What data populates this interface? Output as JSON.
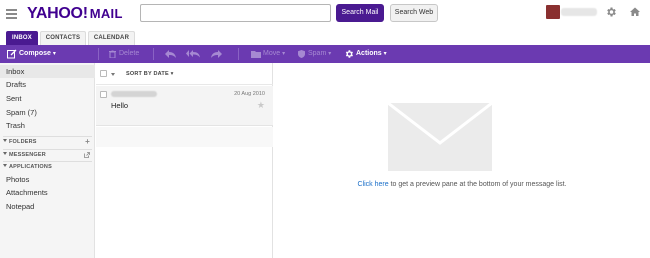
{
  "header": {
    "logo": "YAHOO!",
    "logo_mail": "MAIL",
    "search_value": "",
    "search_placeholder": "",
    "search_mail_label": "Search Mail",
    "search_web_label": "Search Web"
  },
  "tabs": [
    {
      "label": "INBOX",
      "active": true
    },
    {
      "label": "CONTACTS",
      "active": false
    },
    {
      "label": "CALENDAR",
      "active": false
    }
  ],
  "toolbar": {
    "compose": "Compose",
    "delete": "Delete",
    "move": "Move",
    "spam": "Spam",
    "actions": "Actions"
  },
  "sidebar": {
    "folders": [
      "Inbox",
      "Drafts",
      "Sent",
      "Spam (7)",
      "Trash"
    ],
    "section_folders": "FOLDERS",
    "section_messenger": "MESSENGER",
    "section_applications": "APPLICATIONS",
    "apps": [
      "Photos",
      "Attachments",
      "Notepad"
    ]
  },
  "list": {
    "sort_label": "SORT BY DATE",
    "messages": [
      {
        "date": "20 Aug 2010",
        "subject": "Hello"
      }
    ]
  },
  "preview": {
    "link_text": "Click here",
    "message": " to get a preview pane at the bottom of your message list."
  },
  "colors": {
    "brand": "#400090",
    "toolbar": "#6b3ab1",
    "active_tab": "#4a1a91",
    "link": "#1a6ec8"
  }
}
